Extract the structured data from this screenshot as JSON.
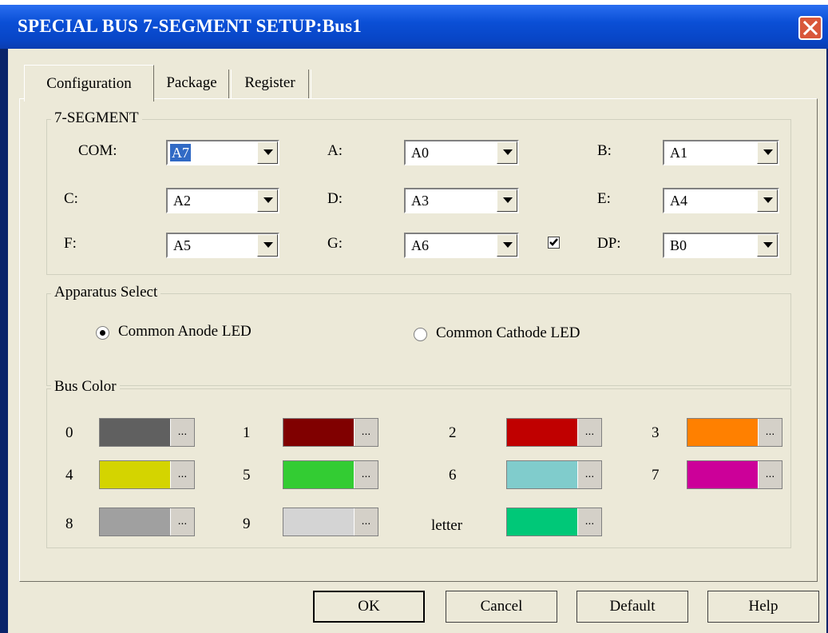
{
  "window": {
    "title": "SPECIAL BUS 7-SEGMENT SETUP:Bus1"
  },
  "tabs": [
    "Configuration",
    "Package",
    "Register"
  ],
  "seven_segment": {
    "group_label": "7-SEGMENT",
    "fields": [
      {
        "label": "COM:",
        "value": "A7"
      },
      {
        "label": "A:",
        "value": "A0"
      },
      {
        "label": "B:",
        "value": "A1"
      },
      {
        "label": "C:",
        "value": "A2"
      },
      {
        "label": "D:",
        "value": "A3"
      },
      {
        "label": "E:",
        "value": "A4"
      },
      {
        "label": "F:",
        "value": "A5"
      },
      {
        "label": "G:",
        "value": "A6"
      },
      {
        "label": "DP:",
        "value": "B0"
      }
    ],
    "dp_enabled": true
  },
  "apparatus": {
    "group_label": "Apparatus Select",
    "options": [
      {
        "label": "Common Anode LED",
        "selected": true
      },
      {
        "label": "Common Cathode LED",
        "selected": false
      }
    ]
  },
  "bus_color": {
    "group_label": "Bus Color",
    "more_label": "...",
    "items": [
      {
        "label": "0",
        "color": "#606060"
      },
      {
        "label": "1",
        "color": "#800000"
      },
      {
        "label": "2",
        "color": "#c00000"
      },
      {
        "label": "3",
        "color": "#ff8000"
      },
      {
        "label": "4",
        "color": "#d4d400"
      },
      {
        "label": "5",
        "color": "#33cc33"
      },
      {
        "label": "6",
        "color": "#80cccc"
      },
      {
        "label": "7",
        "color": "#cc0099"
      },
      {
        "label": "8",
        "color": "#a0a0a0"
      },
      {
        "label": "9",
        "color": "#d4d4d4"
      },
      {
        "label": "letter",
        "color": "#00c878"
      }
    ]
  },
  "buttons": {
    "ok": "OK",
    "cancel": "Cancel",
    "default": "Default",
    "help": "Help"
  }
}
